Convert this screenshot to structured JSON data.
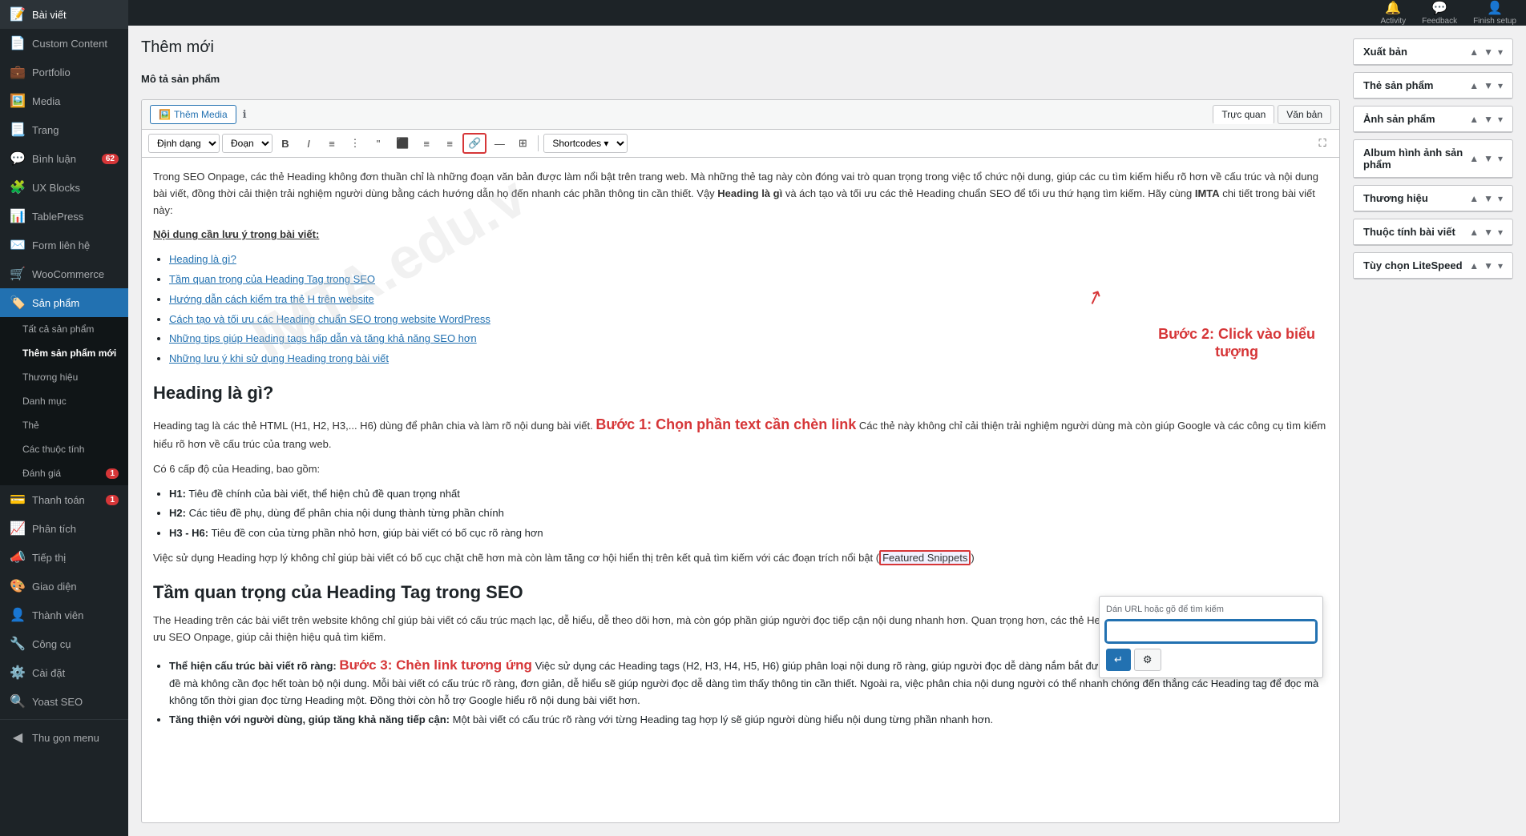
{
  "sidebar": {
    "items": [
      {
        "id": "posts",
        "label": "Bài viết",
        "icon": "📝",
        "badge": null,
        "active": false
      },
      {
        "id": "custom-content",
        "label": "Custom Content",
        "icon": "📄",
        "badge": null,
        "active": false
      },
      {
        "id": "portfolio",
        "label": "Portfolio",
        "icon": "💼",
        "badge": null,
        "active": false
      },
      {
        "id": "media",
        "label": "Media",
        "icon": "🖼️",
        "badge": null,
        "active": false
      },
      {
        "id": "pages",
        "label": "Trang",
        "icon": "📃",
        "badge": null,
        "active": false
      },
      {
        "id": "comments",
        "label": "Bình luận",
        "icon": "💬",
        "badge": "62",
        "active": false
      },
      {
        "id": "ux-blocks",
        "label": "UX Blocks",
        "icon": "🧩",
        "badge": null,
        "active": false
      },
      {
        "id": "tablepress",
        "label": "TablePress",
        "icon": "📊",
        "badge": null,
        "active": false
      },
      {
        "id": "form-lien-he",
        "label": "Form liên hệ",
        "icon": "✉️",
        "badge": null,
        "active": false
      },
      {
        "id": "woocommerce",
        "label": "WooCommerce",
        "icon": "🛒",
        "badge": null,
        "active": false
      },
      {
        "id": "san-pham",
        "label": "Sản phẩm",
        "icon": "🏷️",
        "badge": null,
        "active": true
      },
      {
        "id": "thanh-toan",
        "label": "Thanh toán",
        "icon": "💳",
        "badge": "1",
        "active": false
      },
      {
        "id": "phan-tich",
        "label": "Phân tích",
        "icon": "📈",
        "badge": null,
        "active": false
      },
      {
        "id": "tiep-thi",
        "label": "Tiếp thị",
        "icon": "📣",
        "badge": null,
        "active": false
      },
      {
        "id": "giao-dien",
        "label": "Giao diện",
        "icon": "🎨",
        "badge": null,
        "active": false
      },
      {
        "id": "thanh-vien",
        "label": "Thành viên",
        "icon": "👤",
        "badge": null,
        "active": false
      },
      {
        "id": "cong-cu",
        "label": "Công cụ",
        "icon": "🔧",
        "badge": null,
        "active": false
      },
      {
        "id": "cai-dat",
        "label": "Cài đặt",
        "icon": "⚙️",
        "badge": null,
        "active": false
      },
      {
        "id": "yoast",
        "label": "Yoast SEO",
        "icon": "🔍",
        "badge": null,
        "active": false
      },
      {
        "id": "thu-gon",
        "label": "Thu gọn menu",
        "icon": "◀",
        "badge": null,
        "active": false
      }
    ],
    "submenu": {
      "parent": "san-pham",
      "items": [
        {
          "id": "tat-ca",
          "label": "Tất cả sản phẩm",
          "active": false
        },
        {
          "id": "them-moi",
          "label": "Thêm sản phẩm mới",
          "active": true
        },
        {
          "id": "thuong-hieu",
          "label": "Thương hiệu",
          "active": false
        },
        {
          "id": "danh-muc",
          "label": "Danh mục",
          "active": false
        },
        {
          "id": "the",
          "label": "Thẻ",
          "active": false
        },
        {
          "id": "cac-thuoc-tinh",
          "label": "Các thuộc tính",
          "active": false
        },
        {
          "id": "danh-gia",
          "label": "Đánh giá",
          "badge": "1",
          "active": false
        }
      ]
    }
  },
  "topbar": {
    "activity_label": "Activity",
    "feedback_label": "Feedback",
    "finish_setup_label": "Finish setup"
  },
  "page": {
    "title": "Thêm mới",
    "product_desc_label": "Mô tả sản phẩm"
  },
  "editor": {
    "add_media_label": "Thêm Media",
    "tab_visual": "Trực quan",
    "tab_text": "Văn bản",
    "toolbar": {
      "format_label": "Định dạng",
      "paragraph_label": "Đoạn",
      "shortcodes_label": "Shortcodes"
    },
    "content": {
      "para1": "Trong SEO Onpage, các thẻ Heading không đơn thuần chỉ là những đoạn văn bản được làm nổi bật trên trang web. Mà những thẻ tag này còn đóng vai trò quan trọng trong việc tổ chức nội dung, giúp các cu tìm kiếm hiểu rõ hơn về cấu trúc và nội dung bài viết, đồng thời cải thiện trải nghiệm người dùng bằng cách hướng dẫn họ đến nhanh các phần thông tin cần thiết. Vậy Heading là gì và ách tạo và tối ưu các thẻ Heading chuẩn SEO để tối ưu thứ hạng tìm kiếm. Hãy cùng IMTA chi tiết trong bài viết này:",
      "toc_heading": "Nội dung cần lưu ý trong bài viết:",
      "toc_items": [
        "Heading là gì?",
        "Tầm quan trọng của Heading Tag trong SEO",
        "Hướng dẫn cách kiểm tra thẻ H trên website",
        "Cách tạo và tối ưu các Heading chuẩn SEO trong website WordPress",
        "Những tips giúp Heading tags hấp dẫn và tăng khả năng SEO hơn",
        "Những lưu ý khi sử dụng Heading trong bài viết"
      ],
      "h2_1": "Heading là gì?",
      "para2": "Heading tag là các thẻ HTML (H1, H2, H3,... H6) dùng để phân chia và làm rõ nội dung bài viết. Bước 1: Chọn phần text cần chèn link. Các thẻ này không chỉ cải thiện trải nghiệm người dùng mà còn giúp Google và các công cụ tìm kiếm hiểu rõ hơn về cấu trúc của trang web.",
      "para3": "Có 6 cấp độ của Heading, bao gồm:",
      "heading_items": [
        "H1: Tiêu đề chính của bài viết, thể hiện chủ đề quan trọng nhất",
        "H2: Các tiêu đề phụ, dùng để phân chia nội dung thành từng phần chính",
        "H3 - H6: Tiêu đề con của từng phần nhỏ hơn, giúp bài viết có bố cục rõ ràng hơn"
      ],
      "para4_pre": "Việc sử dụng Heading hợp lý không chỉ giúp bài viết có bố cục chặt chẽ hơn mà còn làm tăng cơ hội hiển thị trên kết quả tìm kiếm với các đoạn trích nổi bật (",
      "para4_link": "Featured Snippets",
      "para4_post": ")",
      "h2_2": "Tầm quan trọng của Heading Tag trong SEO",
      "para5": "The Heading trên các bài viết trên website không chỉ giúp bài viết có cấu trúc mạch lạc, dễ hiểu, dễ theo dõi hơn, mà còn góp phần giúp người đọc tiếp cận nội dung nhanh hơn. Quan trọng hơn, các thẻ Heading còn là một yếu tố quan trọng trong việc tối ưu SEO Onpage, giúp cải thiện hiệu quả tìm kiếm.",
      "para5_items": [
        "Thể hiện cấu trúc bài viết rõ ràng: Bước 3: Chèn link tương ứng. Việc sử dụng các Heading tags (H2, H3, H4, H5, H6) giúp phân loại nội dung rõ ràng, giúp người đọc dễ dàng nắm bắt được cấu trúc tổng thể của bài viết, hiểu được chủ đề mà không cần đọc hết toàn bộ nội dung. Mỗi bài viết có cấu trúc rõ ràng, đơn giản, dễ hiểu sẽ giúp người đọc dễ dàng tìm thấy thông tin cần thiết. Ngoài ra, việc phân chia nội dung người có thể nhanh chóng đến thẳng các Heading tag để đọc mà không tốn thời gian đọc từng Heading một. Đồng thời còn hỗ trợ Google hiểu rõ nội dung bài viết hơn.",
        "Tăng thiện với người dùng, giúp tăng khả năng tiếp cận: Một bài viết có cấu trúc rõ ràng với từng Heading tag hợp lý sẽ giúp người dùng hiểu nội dung từng phần nhanh hơn."
      ]
    }
  },
  "annotations": {
    "step1_label": "Bước 1: Chọn phần\ntext cần chèn link",
    "step2_label": "Bước 2: Click vào biểu\ntượng",
    "step3_label": "Bước 3: Chèn link\ntương ứng"
  },
  "link_popup": {
    "label": "Dán URL hoặc gõ để tìm kiếm",
    "placeholder": ""
  },
  "right_sidebar": {
    "panels": [
      {
        "id": "xuat-ban",
        "label": "Xuất bản",
        "open": true
      },
      {
        "id": "the-san-pham",
        "label": "Thẻ sản phẩm",
        "open": true
      },
      {
        "id": "anh-san-pham",
        "label": "Ảnh sản phẩm",
        "open": true
      },
      {
        "id": "album-anh",
        "label": "Album hình ảnh sản phẩm",
        "open": true
      },
      {
        "id": "thuong-hieu-panel",
        "label": "Thương hiệu",
        "open": true
      },
      {
        "id": "thuoc-tinh",
        "label": "Thuộc tính bài viết",
        "open": true
      },
      {
        "id": "tuy-chon-litespeed",
        "label": "Tùy chọn LiteSpeed",
        "open": true
      }
    ]
  }
}
